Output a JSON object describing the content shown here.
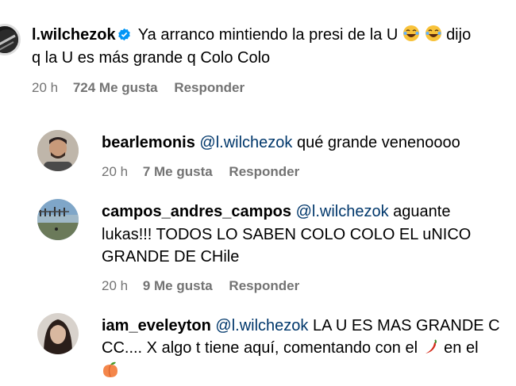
{
  "main_comment": {
    "username": "l.wilchezok",
    "text_line1": "Ya arranco mintiendo la presi de la U",
    "text_line1_end": "dijo",
    "text_line2": "q la U es más grande q Colo Colo",
    "time": "20 h",
    "likes": "724 Me gusta",
    "reply": "Responder"
  },
  "replies": [
    {
      "username": "bearlemonis",
      "mention": "@l.wilchezok",
      "text_line1": "qué grande venenoooo",
      "time": "20 h",
      "likes": "7 Me gusta",
      "reply": "Responder"
    },
    {
      "username": "campos_andres_campos",
      "mention": "@l.wilchezok",
      "text_line1": "aguante",
      "text_line2": "lukas!!! TODOS LO SABEN COLO COLO EL uNICO",
      "text_line3": "GRANDE DE CHile",
      "time": "20 h",
      "likes": "9 Me gusta",
      "reply": "Responder"
    },
    {
      "username": "iam_eveleyton",
      "mention": "@l.wilchezok",
      "text_line1": "LA U ES MAS GRANDE C",
      "text_line2": "CC.... X algo t tiene aquí, comentando con el",
      "text_line2_end": "en el"
    }
  ],
  "colors": {
    "text": "#000000",
    "secondary": "#737373",
    "mention": "#00376b",
    "verified": "#0095f6"
  },
  "icons": [
    "verified-badge-icon",
    "laughing-emoji-icon",
    "chili-pepper-emoji-icon",
    "peach-emoji-icon"
  ]
}
